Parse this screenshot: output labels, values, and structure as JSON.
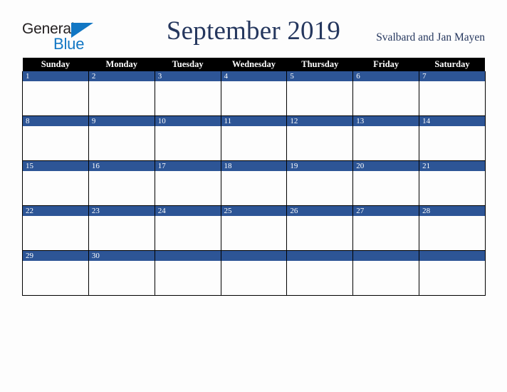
{
  "brand": {
    "name_part1": "General",
    "name_part2": "Blue",
    "triangle_icon": "triangle-icon",
    "color_dark": "#231f20",
    "color_blue": "#1277c4"
  },
  "header": {
    "title": "September 2019",
    "location": "Svalbard and Jan Mayen",
    "title_color": "#25375e"
  },
  "calendar": {
    "header_bg": "#000000",
    "header_text_color": "#ffffff",
    "daynum_band_color": "#2d5596",
    "cell_bg": "#fdfdfd",
    "border_color": "#000000",
    "weekday_headers": [
      "Sunday",
      "Monday",
      "Tuesday",
      "Wednesday",
      "Thursday",
      "Friday",
      "Saturday"
    ],
    "weeks": [
      {
        "days": [
          {
            "num": "1"
          },
          {
            "num": "2"
          },
          {
            "num": "3"
          },
          {
            "num": "4"
          },
          {
            "num": "5"
          },
          {
            "num": "6"
          },
          {
            "num": "7"
          }
        ]
      },
      {
        "days": [
          {
            "num": "8"
          },
          {
            "num": "9"
          },
          {
            "num": "10"
          },
          {
            "num": "11"
          },
          {
            "num": "12"
          },
          {
            "num": "13"
          },
          {
            "num": "14"
          }
        ]
      },
      {
        "days": [
          {
            "num": "15"
          },
          {
            "num": "16"
          },
          {
            "num": "17"
          },
          {
            "num": "18"
          },
          {
            "num": "19"
          },
          {
            "num": "20"
          },
          {
            "num": "21"
          }
        ]
      },
      {
        "days": [
          {
            "num": "22"
          },
          {
            "num": "23"
          },
          {
            "num": "24"
          },
          {
            "num": "25"
          },
          {
            "num": "26"
          },
          {
            "num": "27"
          },
          {
            "num": "28"
          }
        ]
      },
      {
        "days": [
          {
            "num": "29"
          },
          {
            "num": "30"
          },
          {
            "num": ""
          },
          {
            "num": ""
          },
          {
            "num": ""
          },
          {
            "num": ""
          },
          {
            "num": ""
          }
        ]
      }
    ]
  }
}
